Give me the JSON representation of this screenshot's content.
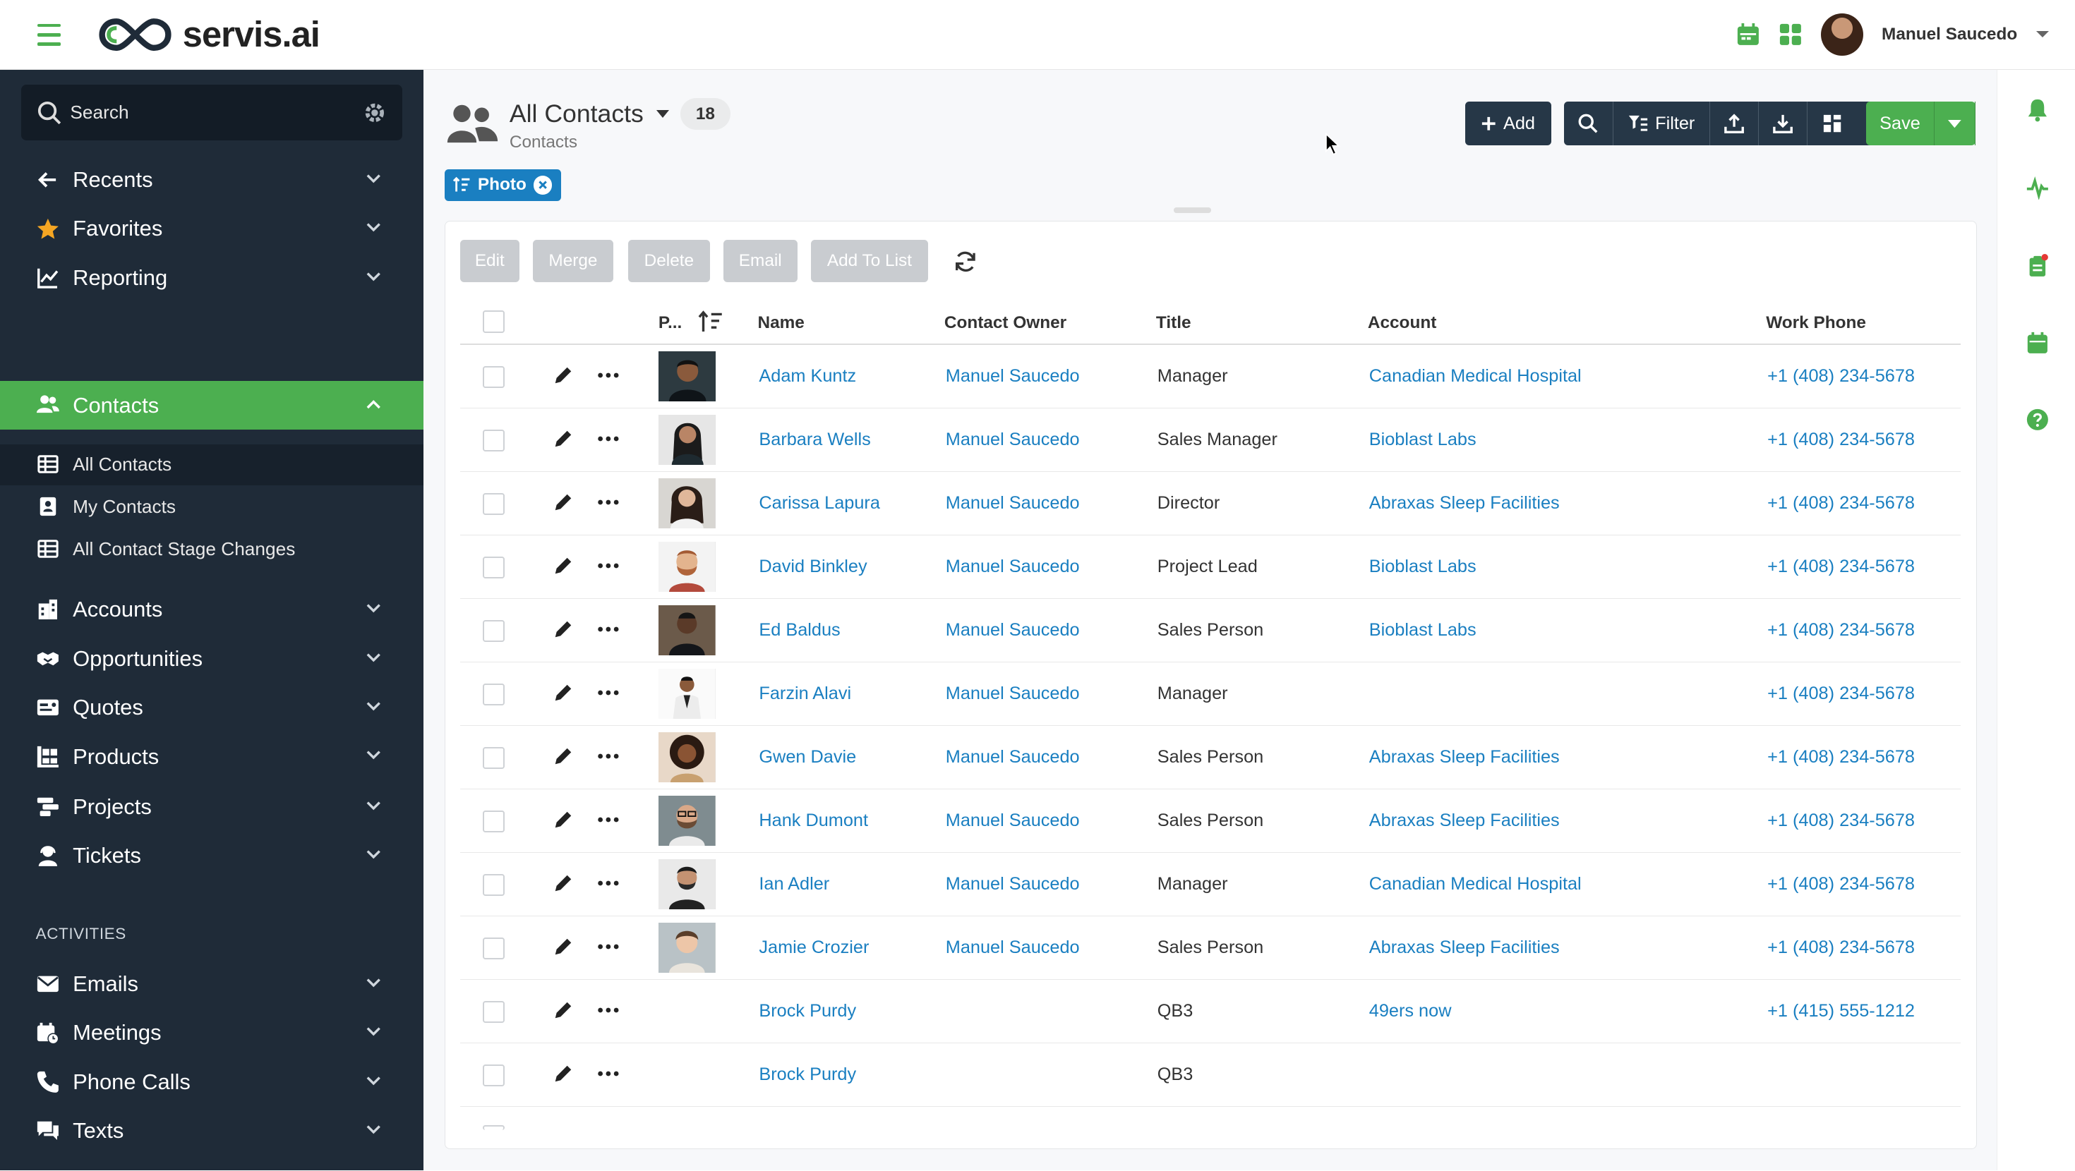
{
  "app": {
    "logo_text": "servis.ai",
    "user_name": "Manuel Saucedo"
  },
  "sidebar": {
    "search_label": "Search",
    "top_items": [
      {
        "label": "Recents",
        "icon": "arrow-left-icon"
      },
      {
        "label": "Favorites",
        "icon": "star-icon"
      },
      {
        "label": "Reporting",
        "icon": "chart-line-icon"
      }
    ],
    "contacts": {
      "label": "Contacts",
      "subitems": [
        "All Contacts",
        "My Contacts",
        "All Contact Stage Changes"
      ]
    },
    "modules": [
      "Accounts",
      "Opportunities",
      "Quotes",
      "Products",
      "Projects",
      "Tickets"
    ],
    "activities_header": "ACTIVITIES",
    "activities": [
      "Emails",
      "Meetings",
      "Phone Calls",
      "Texts"
    ]
  },
  "view": {
    "title": "All Contacts",
    "count": "18",
    "subtitle": "Contacts",
    "filter_chip": "Photo"
  },
  "toolbar": {
    "add_label": "Add",
    "filter_label": "Filter",
    "save_label": "Save"
  },
  "actions": [
    "Edit",
    "Merge",
    "Delete",
    "Email",
    "Add To List"
  ],
  "table": {
    "columns": {
      "photo": "P...",
      "name": "Name",
      "owner": "Contact Owner",
      "title": "Title",
      "account": "Account",
      "phone": "Work Phone"
    },
    "rows": [
      {
        "name": "Adam Kuntz",
        "owner": "Manuel Saucedo",
        "title": "Manager",
        "account": "Canadian Medical Hospital",
        "phone": "+1 (408) 234-5678"
      },
      {
        "name": "Barbara Wells",
        "owner": "Manuel Saucedo",
        "title": "Sales Manager",
        "account": "Bioblast Labs",
        "phone": "+1 (408) 234-5678"
      },
      {
        "name": "Carissa Lapura",
        "owner": "Manuel Saucedo",
        "title": "Director",
        "account": "Abraxas Sleep Facilities",
        "phone": "+1 (408) 234-5678"
      },
      {
        "name": "David Binkley",
        "owner": "Manuel Saucedo",
        "title": "Project Lead",
        "account": "Bioblast Labs",
        "phone": "+1 (408) 234-5678"
      },
      {
        "name": "Ed Baldus",
        "owner": "Manuel Saucedo",
        "title": "Sales Person",
        "account": "Bioblast Labs",
        "phone": "+1 (408) 234-5678"
      },
      {
        "name": "Farzin Alavi",
        "owner": "Manuel Saucedo",
        "title": "Manager",
        "account": "",
        "phone": "+1 (408) 234-5678"
      },
      {
        "name": "Gwen Davie",
        "owner": "Manuel Saucedo",
        "title": "Sales Person",
        "account": "Abraxas Sleep Facilities",
        "phone": "+1 (408) 234-5678"
      },
      {
        "name": "Hank Dumont",
        "owner": "Manuel Saucedo",
        "title": "Sales Person",
        "account": "Abraxas Sleep Facilities",
        "phone": "+1 (408) 234-5678"
      },
      {
        "name": "Ian Adler",
        "owner": "Manuel Saucedo",
        "title": "Manager",
        "account": "Canadian Medical Hospital",
        "phone": "+1 (408) 234-5678"
      },
      {
        "name": "Jamie Crozier",
        "owner": "Manuel Saucedo",
        "title": "Sales Person",
        "account": "Abraxas Sleep Facilities",
        "phone": "+1 (408) 234-5678"
      },
      {
        "name": "Brock Purdy",
        "owner": "",
        "title": "QB3",
        "account": "49ers now",
        "phone": "+1 (415) 555-1212"
      },
      {
        "name": "Brock Purdy",
        "owner": "",
        "title": "QB3",
        "account": "",
        "phone": ""
      }
    ]
  },
  "colors": {
    "accent": "#4caf50",
    "sidebar_bg": "#1f2b38",
    "link": "#1a7fc1",
    "toolbar_dark": "#263747",
    "chip": "#1a7fc1"
  }
}
